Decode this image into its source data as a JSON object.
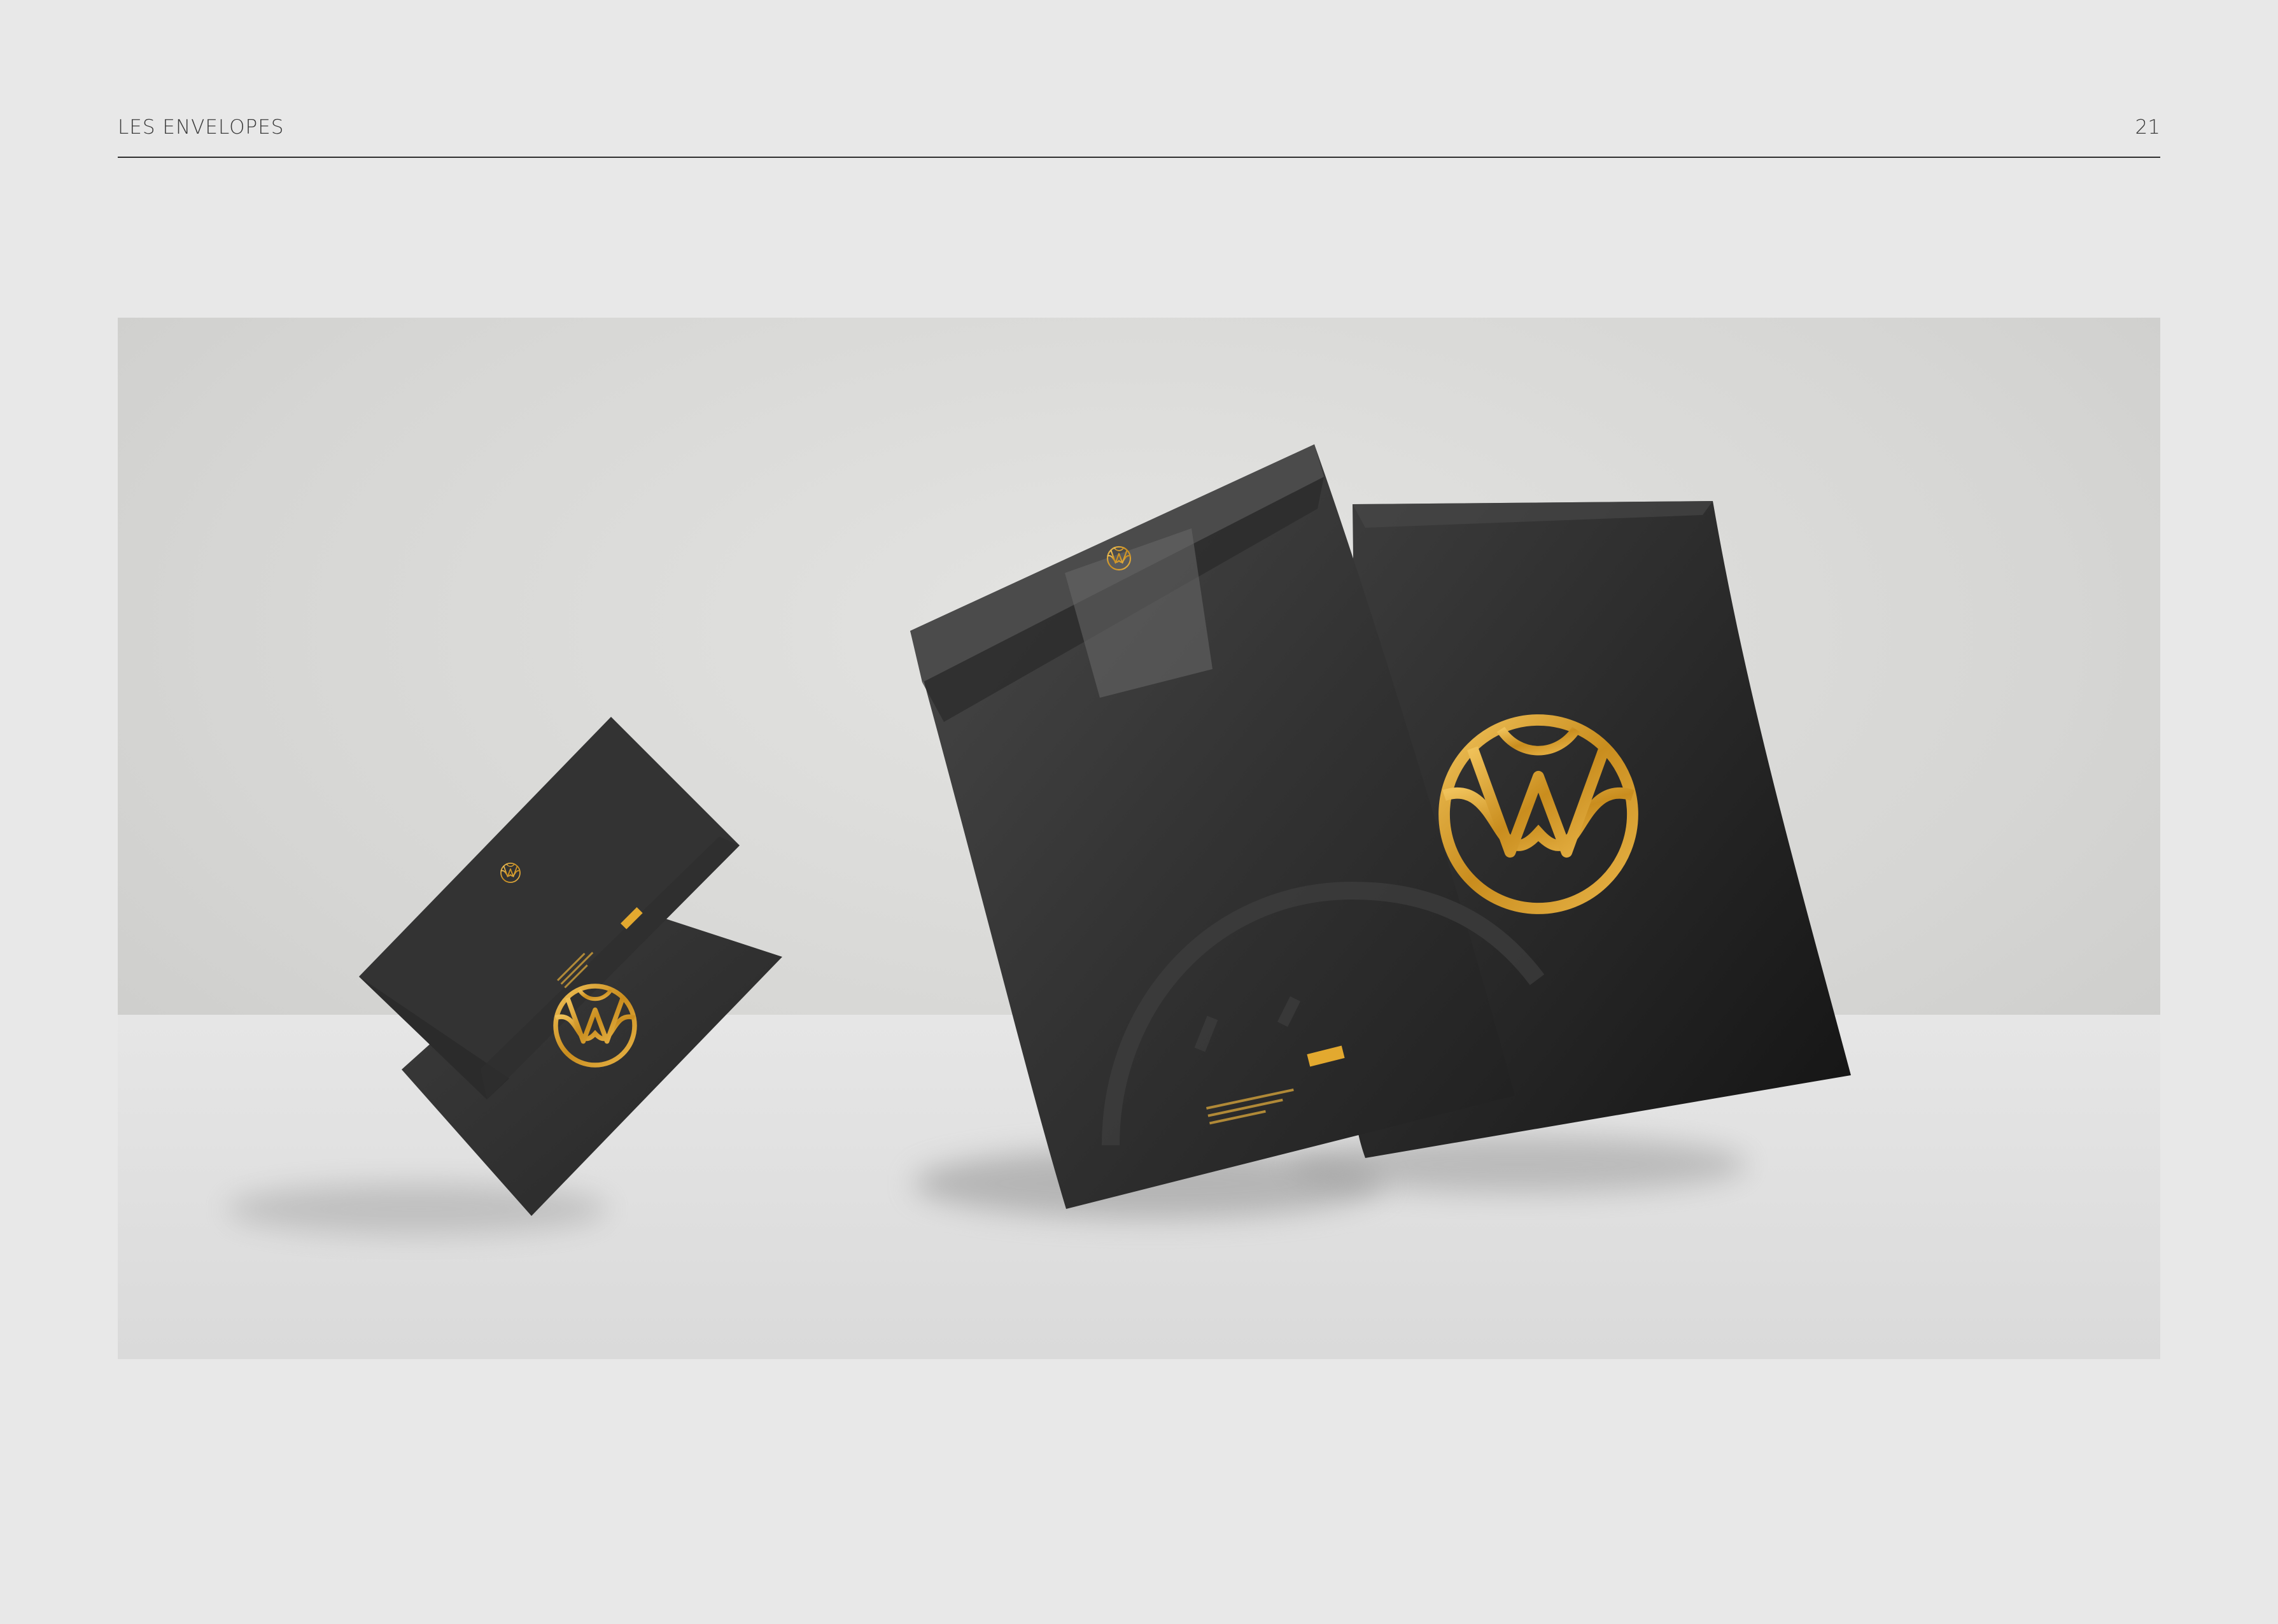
{
  "header": {
    "title": "LES ENVELOPES",
    "page_number": "21"
  },
  "colors": {
    "page_background": "#e8e8e8",
    "envelope_black": "#2a2a2a",
    "logo_gold": "#d9a02c",
    "rule": "#2e2e2e"
  },
  "mockup": {
    "icons": [
      "monogram-logo-icon",
      "brand-badge-icon"
    ]
  }
}
